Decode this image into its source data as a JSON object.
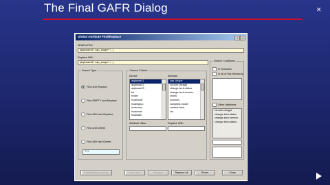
{
  "slide": {
    "title": "The Final GAFR Dialog"
  },
  "dialog": {
    "title": "Global Attribute Find/Replace",
    "what_to_find_label": "What to Find",
    "what_to_find_value": "(aspbase41* cap_shape* *...)",
    "replace_with_label": "Replace With",
    "replace_with_value": "(aspbase41* cap_shape* *...)",
    "search_type": {
      "caption": "Search Type",
      "options": [
        {
          "label": "Find and Replace",
          "selected": true
        },
        {
          "label": "Find EMPTY and Replace",
          "selected": false
        },
        {
          "label": "Find ANY and Replace",
          "selected": false
        },
        {
          "label": "Find and Delete",
          "selected": false
        },
        {
          "label": "Find ANY and Delete",
          "selected": false
        }
      ],
      "extra_value": "???"
    },
    "search_criteria": {
      "caption": "Search Criteria",
      "device_label": "Device",
      "devices": [
        "aspbase41",
        "aspbase42",
        "aspbase43",
        "bit",
        "hcalin",
        "hcalinnoff",
        "hcalingrup",
        "hcalcross",
        "hcalcross",
        "hcalstate"
      ],
      "attribute_label": "Attribute",
      "attributes": [
        "cap_shape",
        "cd-wire-dvdgpt",
        "change-tech-status",
        "change-tech-version",
        "chunk",
        "columns",
        "compiled-model",
        "content-area",
        "cru"
      ],
      "attribute_value_label": "Attribute Value",
      "replace_with_label": "Replace With"
    },
    "search_conditions": {
      "caption": "Search Conditions",
      "in_selection": "In Selection",
      "in_hierarchy": "In All of this Hierarchy",
      "other_attributes": "Other Attributes",
      "other_values": [
        "cd-wire-dvdgpt",
        "change-tech-status",
        "change-tech-version",
        "change-tech-status"
      ]
    },
    "buttons": {
      "find_replace_history": "Find/Replace History",
      "find_next": "Find Next",
      "replace": "Replace",
      "replace_all": "Replace All",
      "reset": "Reset",
      "close": "Close"
    }
  }
}
